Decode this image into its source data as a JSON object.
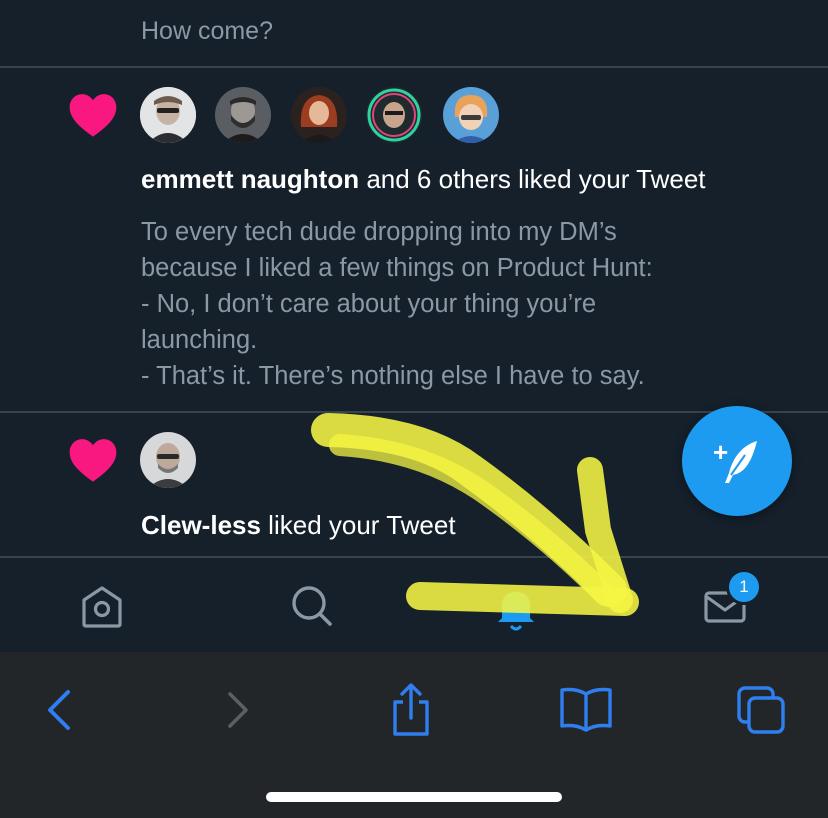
{
  "feed": {
    "previous_reply_text": "How come?",
    "notifications": [
      {
        "type": "like",
        "user": "emmett naughton",
        "action_text": " and 6 others liked your Tweet",
        "avatars": [
          "avatar-1",
          "avatar-2",
          "avatar-3",
          "avatar-4",
          "avatar-5"
        ],
        "tweet_lines": [
          "To every tech dude dropping into my DM’s",
          "because I liked a few things on Product Hunt:",
          "- No, I don’t care about your thing you’re",
          "launching.",
          "- That’s it. There’s nothing else I have to say."
        ]
      },
      {
        "type": "like",
        "user": "Clew-less",
        "action_text": " liked your Tweet",
        "avatars": [
          "avatar-1"
        ]
      }
    ]
  },
  "compose_button": {
    "icon": "compose-feather-icon",
    "label": "+"
  },
  "tabbar": {
    "tabs": [
      {
        "name": "home",
        "icon": "home-icon"
      },
      {
        "name": "search",
        "icon": "search-icon"
      },
      {
        "name": "notifications",
        "icon": "bell-icon",
        "active": true
      },
      {
        "name": "messages",
        "icon": "mail-icon"
      }
    ],
    "messages_badge": "1"
  },
  "browser_toolbar": {
    "buttons": [
      "back-icon",
      "forward-icon",
      "share-icon",
      "bookmarks-icon",
      "tabs-icon"
    ]
  },
  "colors": {
    "background": "#15202b",
    "accent": "#1d9bf0",
    "heart": "#f91880",
    "secondary_text": "#8b98a5",
    "divider": "#38444d",
    "annotation": "#f5f543",
    "safari_bar": "#232629",
    "safari_blue": "#2f7ff0"
  }
}
